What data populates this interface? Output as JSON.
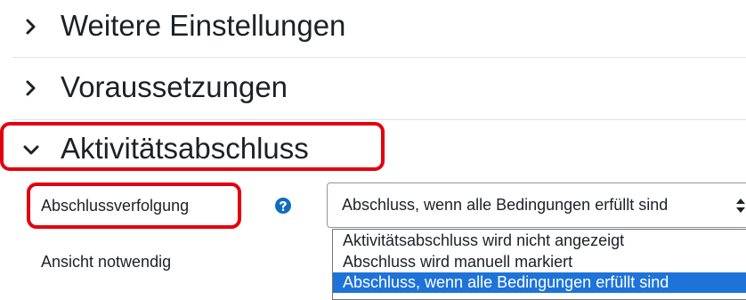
{
  "sections": [
    {
      "title": "Weitere Einstellungen",
      "expanded": false
    },
    {
      "title": "Voraussetzungen",
      "expanded": false
    },
    {
      "title": "Aktivitätsabschluss",
      "expanded": true
    }
  ],
  "completion": {
    "tracking_label": "Abschlussverfolgung",
    "tracking_value": "Abschluss, wenn alle Bedingungen erfüllt sind",
    "options": [
      "Aktivitätsabschluss wird nicht angezeigt",
      "Abschluss wird manuell markiert",
      "Abschluss, wenn alle Bedingungen erfüllt sind"
    ],
    "selected_option_index": 2,
    "view_label": "Ansicht notwendig"
  },
  "colors": {
    "highlight": "#e3000f",
    "selection": "#1e73d8",
    "help_icon": "#0f6cbf"
  },
  "icons": {
    "collapsed": "chevron-right-icon",
    "expanded": "chevron-down-icon",
    "help": "question-circle-icon",
    "select": "sort-arrows-icon"
  }
}
